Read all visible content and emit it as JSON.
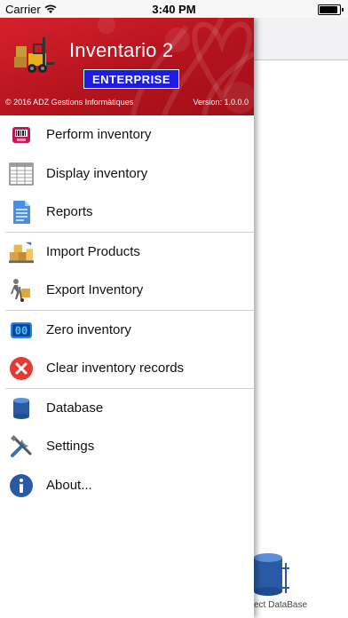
{
  "status_bar": {
    "carrier": "Carrier",
    "time": "3:40 PM",
    "battery_level": 1.0
  },
  "drawer": {
    "header": {
      "app_title": "Inventario 2",
      "edition": "ENTERPRISE",
      "copyright": "© 2016 ADZ Gestions Informàtiques",
      "version": "Version: 1.0.0.0",
      "brand_color": "#c8182a"
    },
    "menu": {
      "items": [
        {
          "label": "Perform inventory",
          "icon": "barcode-scanner-icon"
        },
        {
          "label": "Display inventory",
          "icon": "grid-table-icon"
        },
        {
          "label": "Reports",
          "icon": "document-icon"
        },
        {
          "label": "Import Products",
          "icon": "boxes-import-icon"
        },
        {
          "label": "Export Inventory",
          "icon": "hand-truck-export-icon"
        },
        {
          "label": "Zero inventory",
          "icon": "zero-counter-icon"
        },
        {
          "label": "Clear inventory records",
          "icon": "clear-x-icon"
        },
        {
          "label": "Database",
          "icon": "database-icon"
        },
        {
          "label": "Settings",
          "icon": "wrench-screwdriver-icon"
        },
        {
          "label": "About...",
          "icon": "info-icon"
        }
      ]
    }
  },
  "background": {
    "db_button_label": "ect DataBase"
  }
}
